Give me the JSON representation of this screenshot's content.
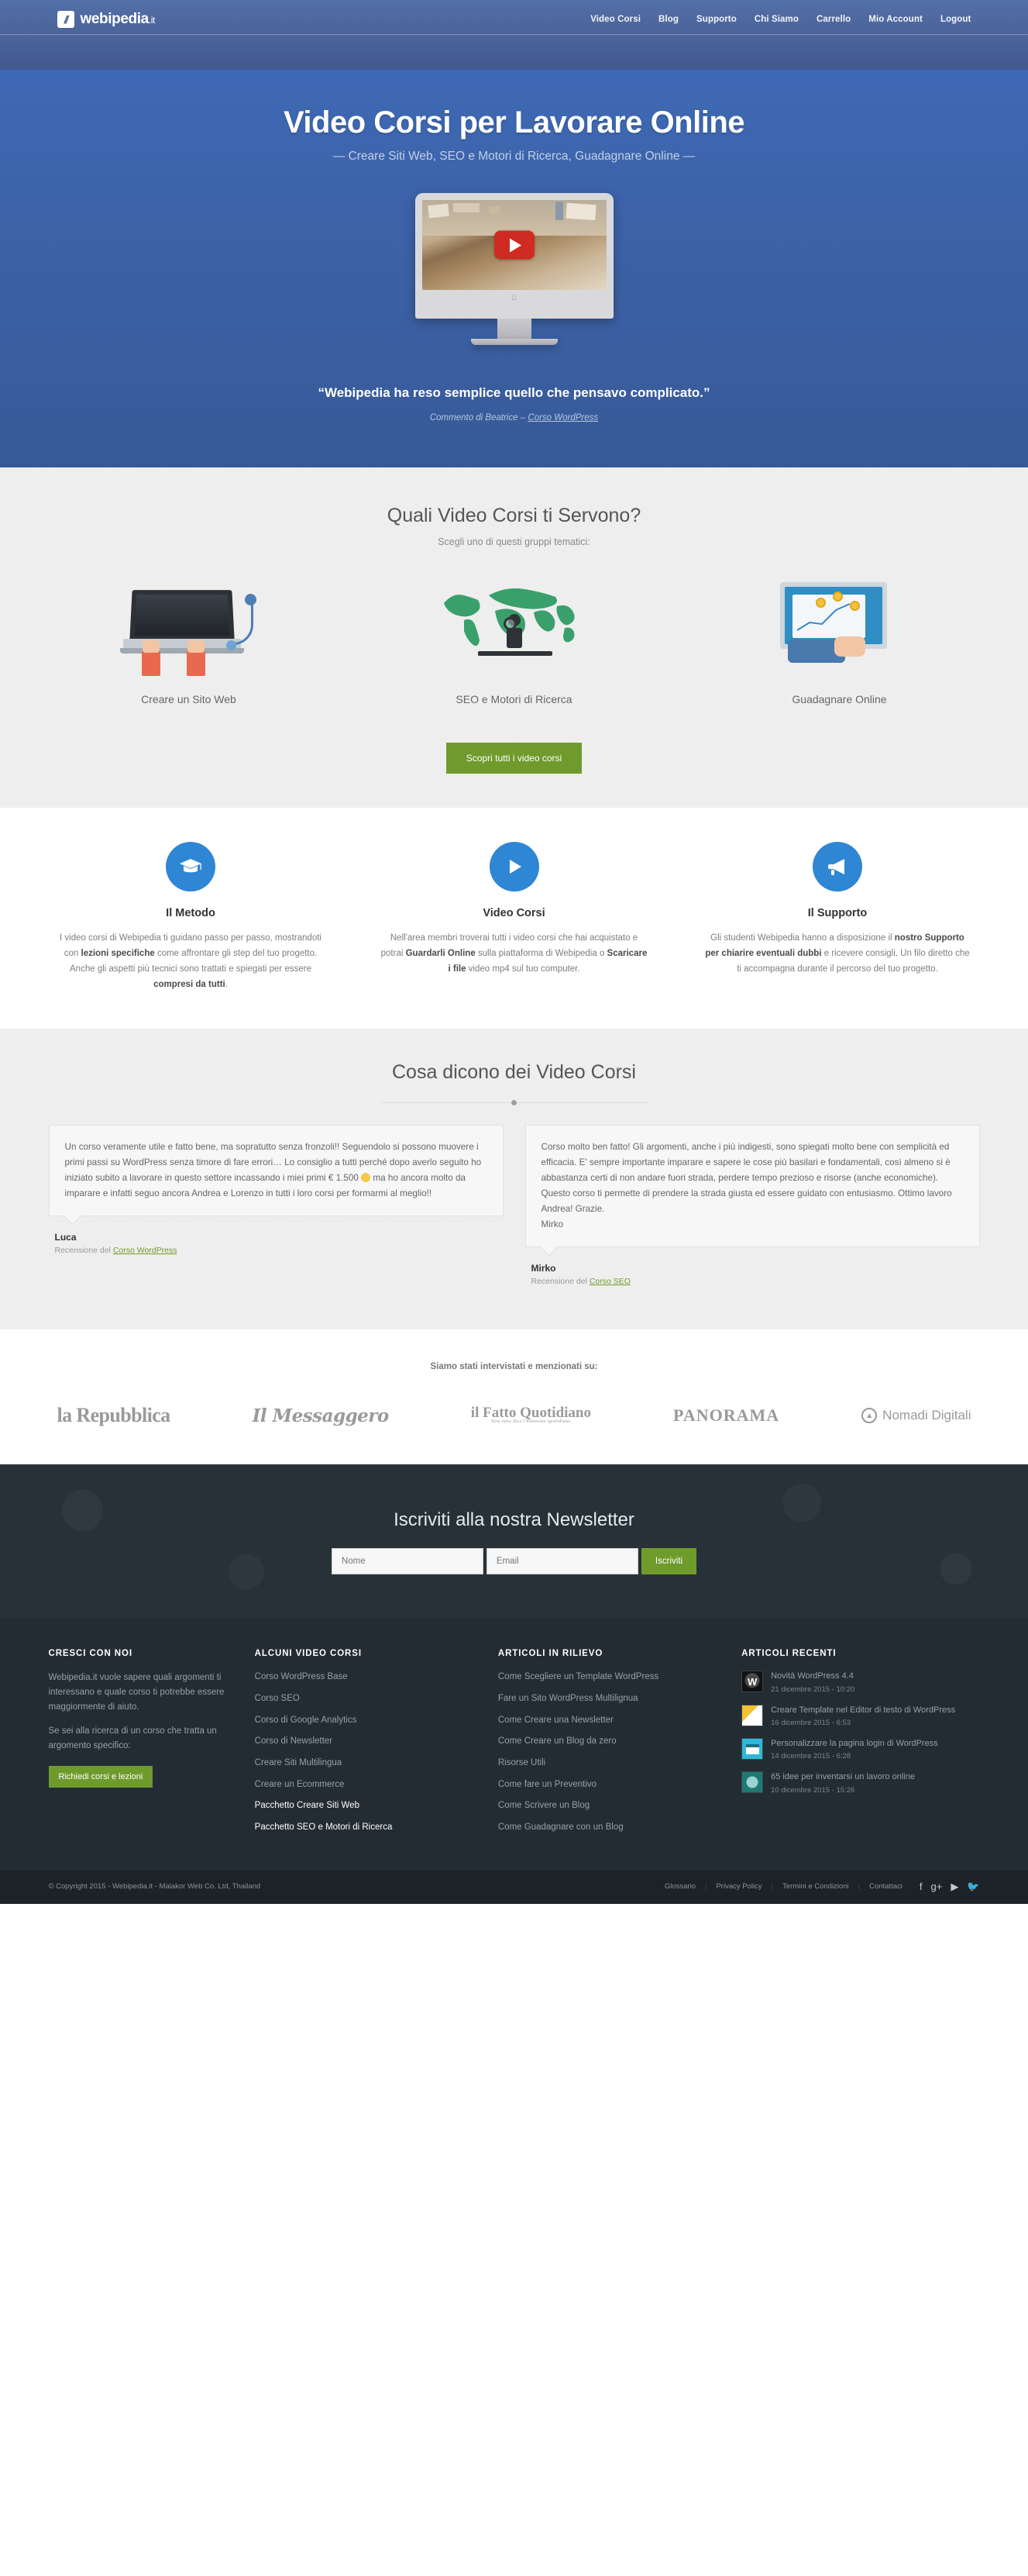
{
  "header": {
    "brand_mark": "//",
    "brand_name": "webipedia",
    "brand_tld": ".it",
    "nav": [
      {
        "label": "Video Corsi"
      },
      {
        "label": "Blog"
      },
      {
        "label": "Supporto"
      },
      {
        "label": "Chi Siamo"
      },
      {
        "label": "Carrello"
      },
      {
        "label": "Mio Account"
      },
      {
        "label": "Logout"
      }
    ]
  },
  "hero": {
    "title": "Video Corsi per Lavorare Online",
    "subtitle": "— Creare Siti Web, SEO e Motori di Ricerca, Guadagnare Online —",
    "video_icon": "play-icon",
    "imac_logo": "apple-logo",
    "quote": "“Webipedia ha reso semplice quello che pensavo complicato.”",
    "quote_author_prefix": "Commento di Beatrice – ",
    "quote_author_link": "Corso WordPress"
  },
  "categories": {
    "title": "Quali Video Corsi ti Servono?",
    "subtitle": "Scegli uno di questi gruppi tematici:",
    "items": [
      {
        "label": "Creare un Sito Web",
        "icon": "laptop-hands-icon"
      },
      {
        "label": "SEO e Motori di Ricerca",
        "icon": "world-map-magnifier-icon"
      },
      {
        "label": "Guadagnare Online",
        "icon": "monitor-chart-coins-icon"
      }
    ],
    "button": "Scopri tutti i video corsi"
  },
  "features": [
    {
      "icon": "graduation-cap-icon",
      "title": "Il Metodo",
      "text_1": "I video corsi di Webipedia ti guidano passo per passo, mostrandoti con ",
      "bold_1": "lezioni specifiche",
      "text_2": " come affrontare gli step del tuo progetto. Anche gli aspetti più tecnici sono trattati e spiegati per essere ",
      "bold_2": "compresi da tutti",
      "text_3": "."
    },
    {
      "icon": "play-circle-icon",
      "title": "Video Corsi",
      "text_1": "Nell'area membri troverai tutti i video corsi che hai acquistato e potrai ",
      "bold_1": "Guardarli Online",
      "text_2": " sulla piattaforma di Webipedia o ",
      "bold_2": "Scaricare i file",
      "text_3": " video mp4 sul tuo computer."
    },
    {
      "icon": "megaphone-icon",
      "title": "Il Supporto",
      "text_1": "Gli studenti Webipedia hanno a disposizione il ",
      "bold_1": "nostro Supporto per chiarire eventuali dubbi",
      "text_2": " e ricevere consigli. Un filo diretto che ti accompagna durante il percorso del tuo progetto.",
      "bold_2": "",
      "text_3": ""
    }
  ],
  "testimonials": {
    "title": "Cosa dicono dei Video Corsi",
    "items": [
      {
        "quote_part1": "Un corso veramente utile e fatto bene, ma sopratutto senza fronzoli!! Seguendolo si possono muovere i primi passi su WordPress senza timore di fare errori… Lo consiglio a tutti perché dopo averlo seguito ho iniziato subito a lavorare in questo settore incassando i miei primi € 1.500 ",
        "quote_part2": " ma ho ancora molto da imparare e infatti seguo ancora Andrea e Lorenzo in tutti i loro corsi per formarmi al meglio!!",
        "emoji": "smiley-icon",
        "name": "Luca",
        "source_prefix": "Recensione del ",
        "source_link": "Corso WordPress"
      },
      {
        "quote_part1": "Corso molto ben fatto! Gli argomenti, anche i più indigesti, sono spiegati molto bene con semplicità ed efficacia. E' sempre importante imparare e sapere le cose più basilari e fondamentali, così almeno si è abbastanza certi di non andare fuori strada, perdere tempo prezioso e risorse (anche economiche). Questo corso ti permette di prendere la strada giusta ed essere guidato con entusiasmo. Ottimo lavoro Andrea! Grazie.\nMirko",
        "quote_part2": "",
        "emoji": "",
        "name": "Mirko",
        "source_prefix": "Recensione del ",
        "source_link": "Corso SEO"
      }
    ]
  },
  "press": {
    "title": "Siamo stati intervistati e menzionati su:",
    "logos": [
      {
        "name": "la Repubblica"
      },
      {
        "name": "Il Messaggero"
      },
      {
        "name": "il Fatto Quotidiano",
        "sub": "Non tutte dico l'numerate quotidiano"
      },
      {
        "name": "PANORAMA"
      },
      {
        "name": "Nomadi Digitali"
      }
    ]
  },
  "newsletter": {
    "title": "Iscriviti alla nostra Newsletter",
    "name_placeholder": "Nome",
    "email_placeholder": "Email",
    "submit": "Iscriviti"
  },
  "footer": {
    "col1": {
      "heading": "CRESCI CON NOI",
      "p1": "Webipedia.it vuole sapere quali argomenti ti interessano e quale corso ti potrebbe essere maggiormente di aiuto.",
      "p2": "Se sei alla ricerca di un corso che tratta un argomento specifico:",
      "button": "Richiedi corsi e lezioni"
    },
    "col2": {
      "heading": "ALCUNI VIDEO CORSI",
      "items": [
        {
          "label": "Corso WordPress Base",
          "strong": false
        },
        {
          "label": "Corso SEO",
          "strong": false
        },
        {
          "label": "Corso di Google Analytics",
          "strong": false
        },
        {
          "label": "Corso di Newsletter",
          "strong": false
        },
        {
          "label": "Creare Siti Multilingua",
          "strong": false
        },
        {
          "label": "Creare un Ecommerce",
          "strong": false
        },
        {
          "label": "Pacchetto Creare Siti Web",
          "strong": true
        },
        {
          "label": "Pacchetto SEO e Motori di Ricerca",
          "strong": true
        }
      ]
    },
    "col3": {
      "heading": "ARTICOLI IN RILIEVO",
      "items": [
        {
          "label": "Come Scegliere un Template WordPress"
        },
        {
          "label": "Fare un Sito WordPress Multilignua"
        },
        {
          "label": "Come Creare una Newsletter"
        },
        {
          "label": "Come Creare un Blog da zero"
        },
        {
          "label": "Risorse Utili"
        },
        {
          "label": "Come fare un Preventivo"
        },
        {
          "label": "Come Scrivere un Blog"
        },
        {
          "label": "Come Guadagnare con un Blog"
        }
      ]
    },
    "col4": {
      "heading": "ARTICOLI RECENTI",
      "items": [
        {
          "title": "Novità WordPress 4.4",
          "date": "21 dicembre 2015 - 10:20",
          "thumb": "wordpress-logo-thumb"
        },
        {
          "title": "Creare Template nel Editor di testo di WordPress",
          "date": "16 dicembre 2015 - 6:53",
          "thumb": "document-thumb"
        },
        {
          "title": "Personalizzare la pagina login di WordPress",
          "date": "14 dicembre 2015 - 6:28",
          "thumb": "login-window-thumb"
        },
        {
          "title": "65 idee per inventarsi un lavoro online",
          "date": "10 dicembre 2015 - 15:26",
          "thumb": "brain-thumb"
        }
      ]
    }
  },
  "bottombar": {
    "copyright": "© Copyright 2015 - Webipedia.it - Malakor Web Co. Ltd, Thailand",
    "links": [
      {
        "label": "Glossario"
      },
      {
        "label": "Privacy Policy"
      },
      {
        "label": "Termini e Condizioni"
      },
      {
        "label": "Contattaci"
      }
    ],
    "social": [
      {
        "icon": "facebook-icon",
        "glyph": "f"
      },
      {
        "icon": "google-plus-icon",
        "glyph": "g+"
      },
      {
        "icon": "youtube-icon",
        "glyph": "▶"
      },
      {
        "icon": "twitter-icon",
        "glyph": "🐦"
      }
    ]
  },
  "colors": {
    "brand_blue": "#3e69b4",
    "header_blue": "#4a6398",
    "accent_green": "#6f9b2d",
    "dark_footer": "#232c33",
    "dark_newsletter": "#273238"
  }
}
